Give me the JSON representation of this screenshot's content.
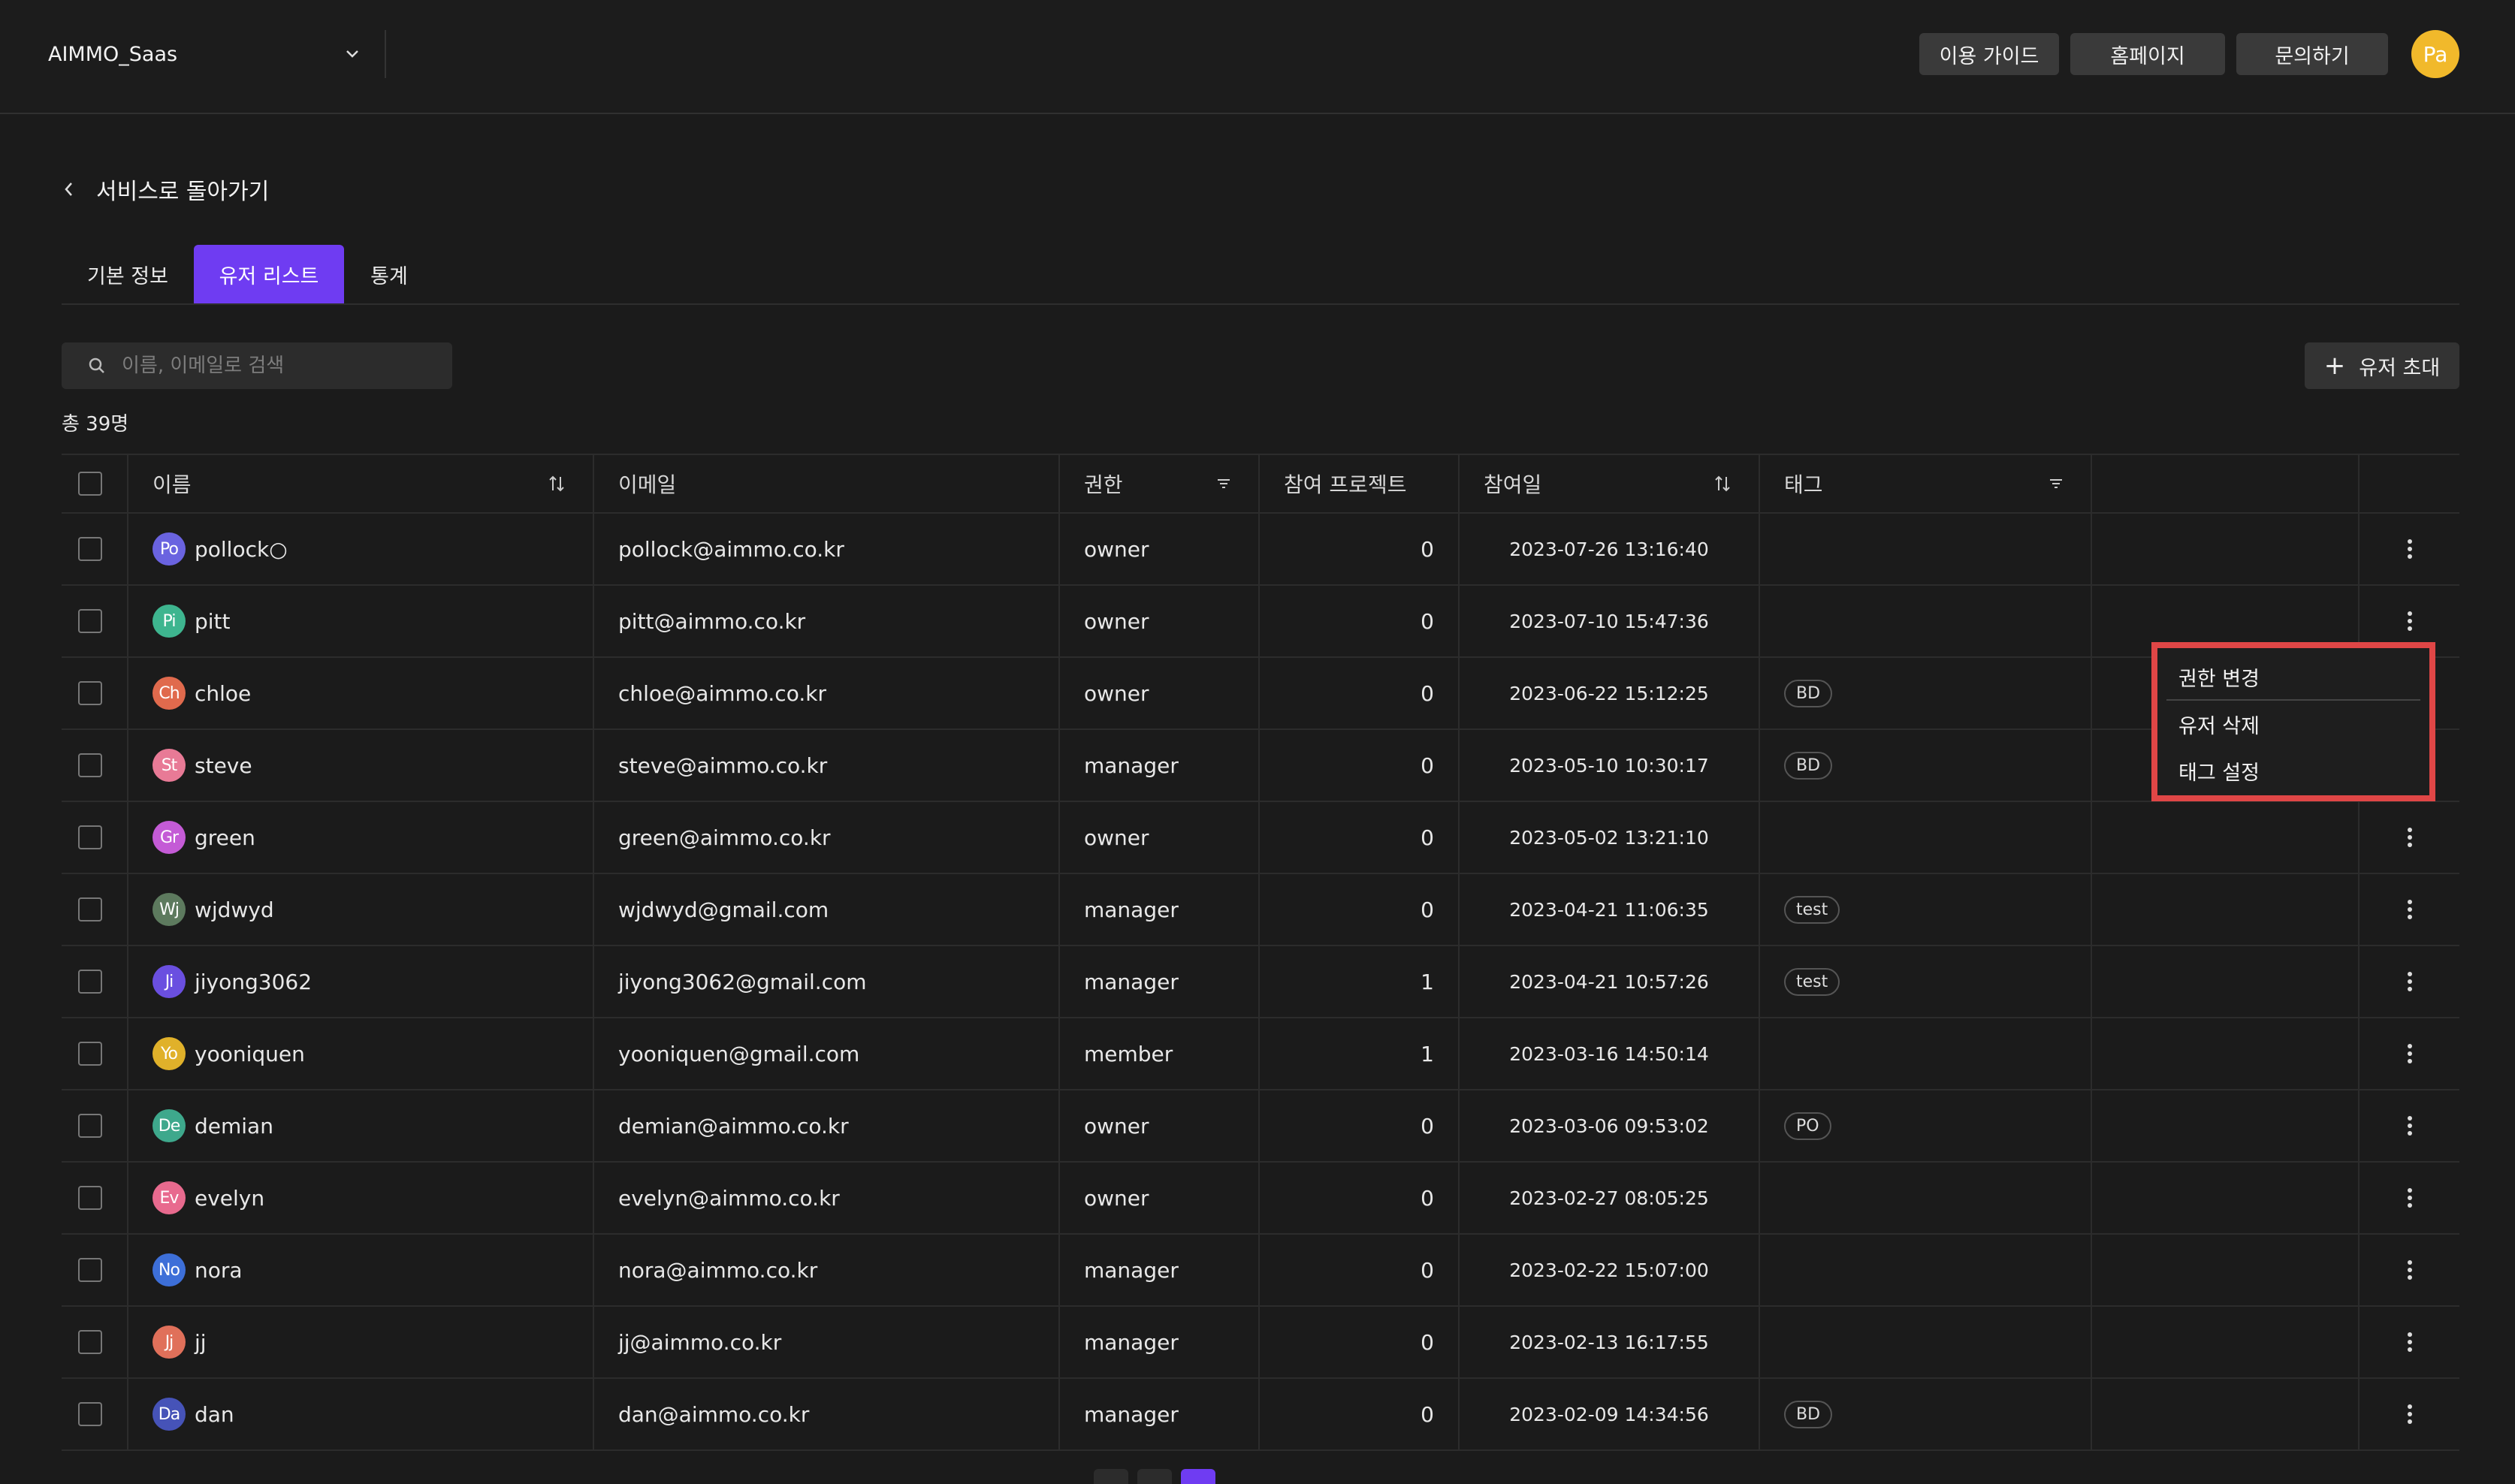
{
  "header": {
    "workspace": "AIMMO_Saas",
    "buttons": [
      "이용 가이드",
      "홈페이지",
      "문의하기"
    ],
    "profile_initials": "Pa",
    "profile_color": "#f1b92b"
  },
  "back_label": "서비스로 돌아가기",
  "tabs": [
    {
      "label": "기본 정보",
      "active": false
    },
    {
      "label": "유저 리스트",
      "active": true
    },
    {
      "label": "통계",
      "active": false
    }
  ],
  "search": {
    "placeholder": "이름, 이메일로 검색"
  },
  "invite_label": "유저 초대",
  "total_count": "총 39명",
  "table": {
    "columns": [
      "이름",
      "이메일",
      "권한",
      "참여 프로젝트",
      "참여일",
      "태그"
    ],
    "rows": [
      {
        "initials": "Po",
        "color": "#6a63e0",
        "name": "pollock○",
        "email": "pollock@aimmo.co.kr",
        "role": "owner",
        "projects": "0",
        "joined": "2023-07-26 13:16:40",
        "tag": ""
      },
      {
        "initials": "Pi",
        "color": "#3eb58f",
        "name": "pitt",
        "email": "pitt@aimmo.co.kr",
        "role": "owner",
        "projects": "0",
        "joined": "2023-07-10 15:47:36",
        "tag": ""
      },
      {
        "initials": "Ch",
        "color": "#e06a4d",
        "name": "chloe",
        "email": "chloe@aimmo.co.kr",
        "role": "owner",
        "projects": "0",
        "joined": "2023-06-22 15:12:25",
        "tag": "BD"
      },
      {
        "initials": "St",
        "color": "#e87a96",
        "name": "steve",
        "email": "steve@aimmo.co.kr",
        "role": "manager",
        "projects": "0",
        "joined": "2023-05-10 10:30:17",
        "tag": "BD"
      },
      {
        "initials": "Gr",
        "color": "#c45bd6",
        "name": "green",
        "email": "green@aimmo.co.kr",
        "role": "owner",
        "projects": "0",
        "joined": "2023-05-02 13:21:10",
        "tag": ""
      },
      {
        "initials": "Wj",
        "color": "#5d7a5e",
        "name": "wjdwyd",
        "email": "wjdwyd@gmail.com",
        "role": "manager",
        "projects": "0",
        "joined": "2023-04-21 11:06:35",
        "tag": "test"
      },
      {
        "initials": "Ji",
        "color": "#6a4fe0",
        "name": "jiyong3062",
        "email": "jiyong3062@gmail.com",
        "role": "manager",
        "projects": "1",
        "joined": "2023-04-21 10:57:26",
        "tag": "test"
      },
      {
        "initials": "Yo",
        "color": "#e0b12a",
        "name": "yooniquen",
        "email": "yooniquen@gmail.com",
        "role": "member",
        "projects": "1",
        "joined": "2023-03-16 14:50:14",
        "tag": ""
      },
      {
        "initials": "De",
        "color": "#3ea88c",
        "name": "demian",
        "email": "demian@aimmo.co.kr",
        "role": "owner",
        "projects": "0",
        "joined": "2023-03-06 09:53:02",
        "tag": "PO"
      },
      {
        "initials": "Ev",
        "color": "#e86a8e",
        "name": "evelyn",
        "email": "evelyn@aimmo.co.kr",
        "role": "owner",
        "projects": "0",
        "joined": "2023-02-27 08:05:25",
        "tag": ""
      },
      {
        "initials": "No",
        "color": "#3d6fd8",
        "name": "nora",
        "email": "nora@aimmo.co.kr",
        "role": "manager",
        "projects": "0",
        "joined": "2023-02-22 15:07:00",
        "tag": ""
      },
      {
        "initials": "Jj",
        "color": "#e0705a",
        "name": "jj",
        "email": "jj@aimmo.co.kr",
        "role": "manager",
        "projects": "0",
        "joined": "2023-02-13 16:17:55",
        "tag": ""
      },
      {
        "initials": "Da",
        "color": "#4653b8",
        "name": "dan",
        "email": "dan@aimmo.co.kr",
        "role": "manager",
        "projects": "0",
        "joined": "2023-02-09 14:34:56",
        "tag": "BD"
      }
    ]
  },
  "context_menu": {
    "items": [
      "권한 변경",
      "유저 삭제",
      "태그 설정"
    ],
    "highlight_color": "#e04646"
  },
  "accent_color": "#6f3cf2"
}
